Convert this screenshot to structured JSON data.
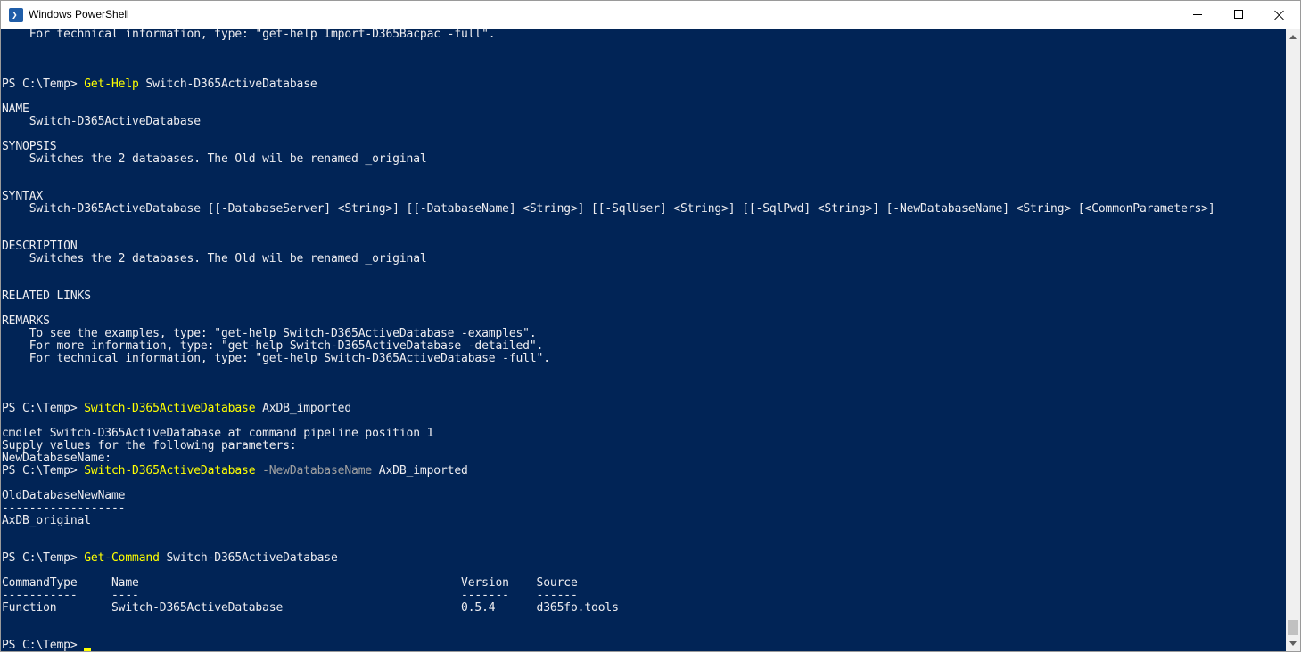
{
  "window": {
    "title": "Windows PowerShell",
    "icon": "powershell-icon",
    "icon_glyph": "❯",
    "controls": [
      "minimize-icon",
      "maximize-icon",
      "close-icon"
    ]
  },
  "colors": {
    "console_background": "#012456",
    "console_text": "#eeedf0",
    "command_text": "#ffff00",
    "parameter_text": "#a0a0a0",
    "titlebar": "#ffffff"
  },
  "console": {
    "help_tail_line": "    For technical information, type: \"get-help Import-D365Bacpac -full\".",
    "cmd1": {
      "prompt": "PS C:\\Temp> ",
      "command": "Get-Help",
      "args": " Switch-D365ActiveDatabase"
    },
    "help": {
      "name_header": "NAME",
      "name_value": "    Switch-D365ActiveDatabase",
      "synopsis_header": "SYNOPSIS",
      "synopsis_value": "    Switches the 2 databases. The Old wil be renamed _original",
      "syntax_header": "SYNTAX",
      "syntax_value": "    Switch-D365ActiveDatabase [[-DatabaseServer] <String>] [[-DatabaseName] <String>] [[-SqlUser] <String>] [[-SqlPwd] <String>] [-NewDatabaseName] <String> [<CommonParameters>]",
      "description_header": "DESCRIPTION",
      "description_value": "    Switches the 2 databases. The Old wil be renamed _original",
      "related_links_header": "RELATED LINKS",
      "remarks_header": "REMARKS",
      "remarks_lines": [
        "    To see the examples, type: \"get-help Switch-D365ActiveDatabase -examples\".",
        "    For more information, type: \"get-help Switch-D365ActiveDatabase -detailed\".",
        "    For technical information, type: \"get-help Switch-D365ActiveDatabase -full\"."
      ]
    },
    "cmd2": {
      "prompt": "PS C:\\Temp> ",
      "command": "Switch-D365ActiveDatabase",
      "args": " AxDB_imported"
    },
    "pipeline_lines": [
      "cmdlet Switch-D365ActiveDatabase at command pipeline position 1",
      "Supply values for the following parameters:",
      "NewDatabaseName:"
    ],
    "cmd3": {
      "prompt": "PS C:\\Temp> ",
      "command": "Switch-D365ActiveDatabase",
      "param": " -NewDatabaseName",
      "args": " AxDB_imported"
    },
    "result1": {
      "header": "OldDatabaseNewName",
      "underline": "------------------",
      "value": "AxDB_original"
    },
    "cmd4": {
      "prompt": "PS C:\\Temp> ",
      "command": "Get-Command",
      "args": " Switch-D365ActiveDatabase"
    },
    "result2": {
      "header_line": "CommandType     Name                                               Version    Source",
      "underline_line": "-----------     ----                                               -------    ------",
      "row_line": "Function        Switch-D365ActiveDatabase                          0.5.4      d365fo.tools"
    },
    "final_prompt": "PS C:\\Temp> "
  },
  "scrollbar": {
    "up_icon": "scroll-up-arrow-icon",
    "down_icon": "scroll-down-arrow-icon"
  }
}
